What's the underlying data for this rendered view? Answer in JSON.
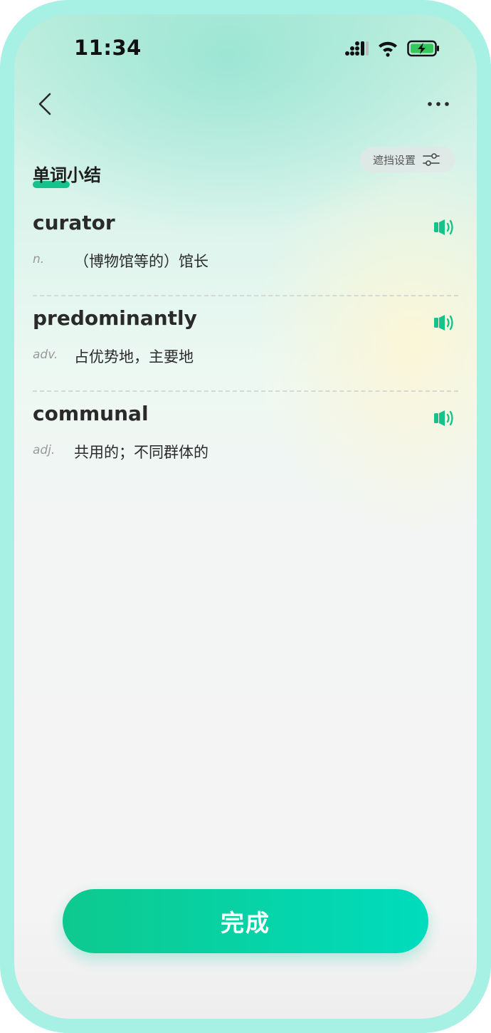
{
  "status_bar": {
    "time": "11:34",
    "icons": [
      "signal-icon",
      "wifi-icon",
      "battery-charging-icon"
    ]
  },
  "header": {
    "back_icon": "chevron-left-icon",
    "more_icon": "more-horizontal-icon"
  },
  "section": {
    "title": "单词小结",
    "mask_settings_label": "遮挡设置",
    "mask_settings_icon": "filter-sliders-icon"
  },
  "words": [
    {
      "word": "curator",
      "pos": "n.",
      "meaning": "（博物馆等的）馆长",
      "icon": "speaker-icon"
    },
    {
      "word": "predominantly",
      "pos": "adv.",
      "meaning": "占优势地，主要地",
      "icon": "speaker-icon"
    },
    {
      "word": "communal",
      "pos": "adj.",
      "meaning": "共用的；不同群体的",
      "icon": "speaker-icon"
    }
  ],
  "done_button": {
    "label": "完成"
  },
  "colors": {
    "accent": "#16c28b",
    "button_start": "#0ec98e",
    "button_end": "#00dcbd",
    "frame": "#a6f0e4"
  }
}
